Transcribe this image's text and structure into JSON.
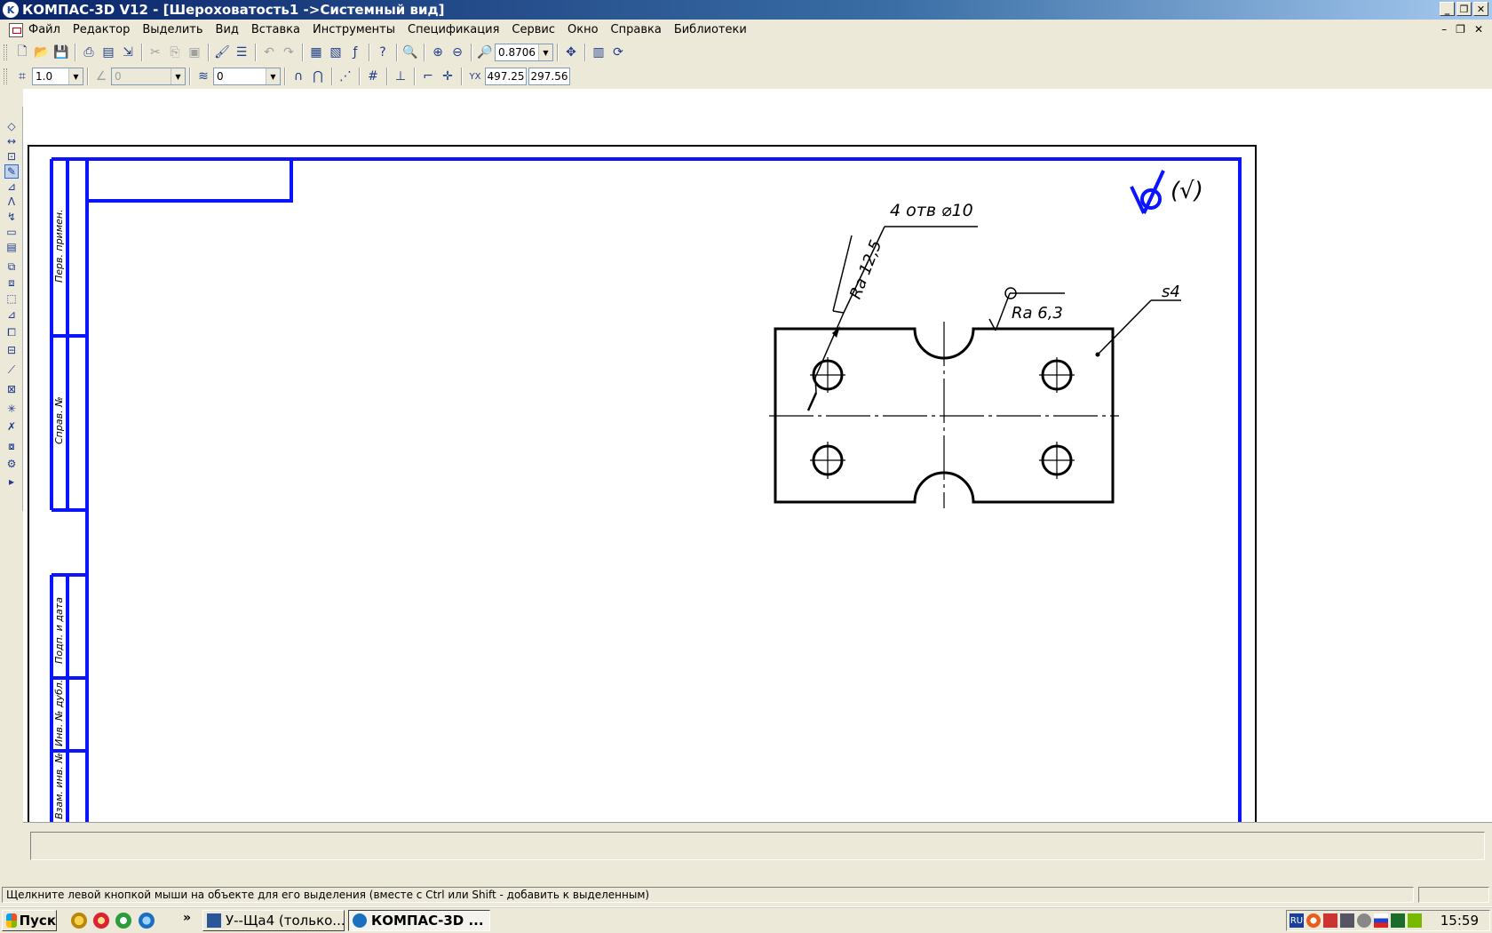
{
  "titlebar": {
    "title": "КОМПАС-3D V12 - [Шероховатость1 ->Системный вид]",
    "app_icon_letter": "K",
    "minimize": "_",
    "restore": "❐",
    "close": "✕"
  },
  "menu": {
    "items": [
      "Файл",
      "Редактор",
      "Выделить",
      "Вид",
      "Вставка",
      "Инструменты",
      "Спецификация",
      "Сервис",
      "Окно",
      "Справка",
      "Библиотеки"
    ],
    "mdi_minimize": "–",
    "mdi_restore": "❐",
    "mdi_close": "✕"
  },
  "toolbar": {
    "zoom_value": "0.8706",
    "step_value": "1.0",
    "angle_value": "0",
    "layer_value": "0",
    "coord_x": "497.25",
    "coord_y": "297.56",
    "coord_label": "YX"
  },
  "drawing": {
    "holes_label": "4 отв ⌀10",
    "roughness_hole": "Ra 12,5",
    "roughness_surface": "Ra 6,3",
    "thickness_label": "s4",
    "general_roughness": "(√)",
    "stamp_labels": [
      "Перв. примен.",
      "Справ. №",
      "Подп. и дата",
      "Инв. № дубл.",
      "Взам. инв. №"
    ]
  },
  "status": {
    "hint": "Щелкните левой кнопкой мыши на объекте для его выделения (вместе с Ctrl или Shift - добавить к выделенным)"
  },
  "taskbar": {
    "start": "Пуск",
    "overflow": "»",
    "tasks": [
      "У--Ща4 (только...",
      "КОМПАС-3D ..."
    ],
    "tray_lang": "RU",
    "clock": "15:59"
  },
  "colors": {
    "frame_blue": "#0a14ff",
    "title_blue": "#0a246a"
  }
}
